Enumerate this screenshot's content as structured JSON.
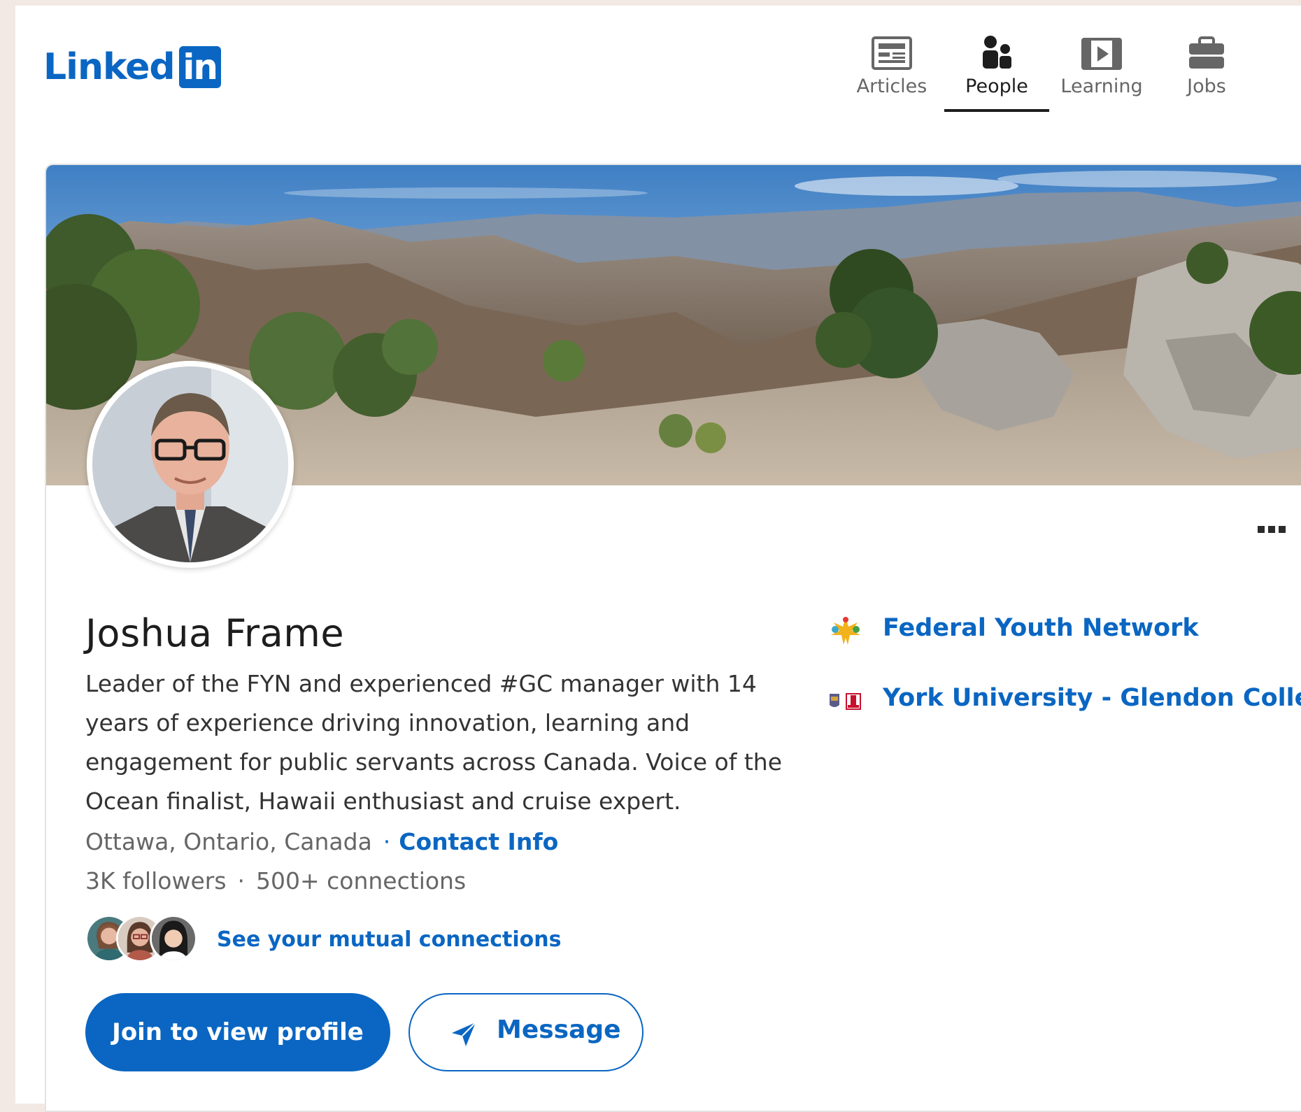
{
  "brand": {
    "logo_text": "Linked",
    "logo_box_text": "in",
    "color": "#0a66c2"
  },
  "nav": {
    "items": [
      {
        "label": "Articles",
        "icon": "articles-icon",
        "active": false
      },
      {
        "label": "People",
        "icon": "people-icon",
        "active": true
      },
      {
        "label": "Learning",
        "icon": "learning-icon",
        "active": false
      },
      {
        "label": "Jobs",
        "icon": "briefcase-icon",
        "active": false
      }
    ]
  },
  "profile": {
    "name": "Joshua Frame",
    "headline": "Leader of the FYN and experienced #GC manager with 14 years of experience driving innovation, learning and engagement for public servants across Canada. Voice of the Ocean finalist, Hawaii enthusiast and cruise expert.",
    "location": "Ottawa, Ontario, Canada",
    "location_separator": "·",
    "contact_info_label": "Contact Info",
    "followers": "3K followers",
    "stats_separator": "·",
    "connections": "500+ connections",
    "mutual_connections_label": "See your mutual connections"
  },
  "organizations": [
    {
      "name": "Federal Youth Network",
      "icon": "federal-youth-network-logo"
    },
    {
      "name": "York University - Glendon College",
      "icon": "york-university-logo"
    }
  ],
  "actions": {
    "join_label": "Join to view profile",
    "message_label": "Message",
    "more_icon": "more-options-icon"
  }
}
